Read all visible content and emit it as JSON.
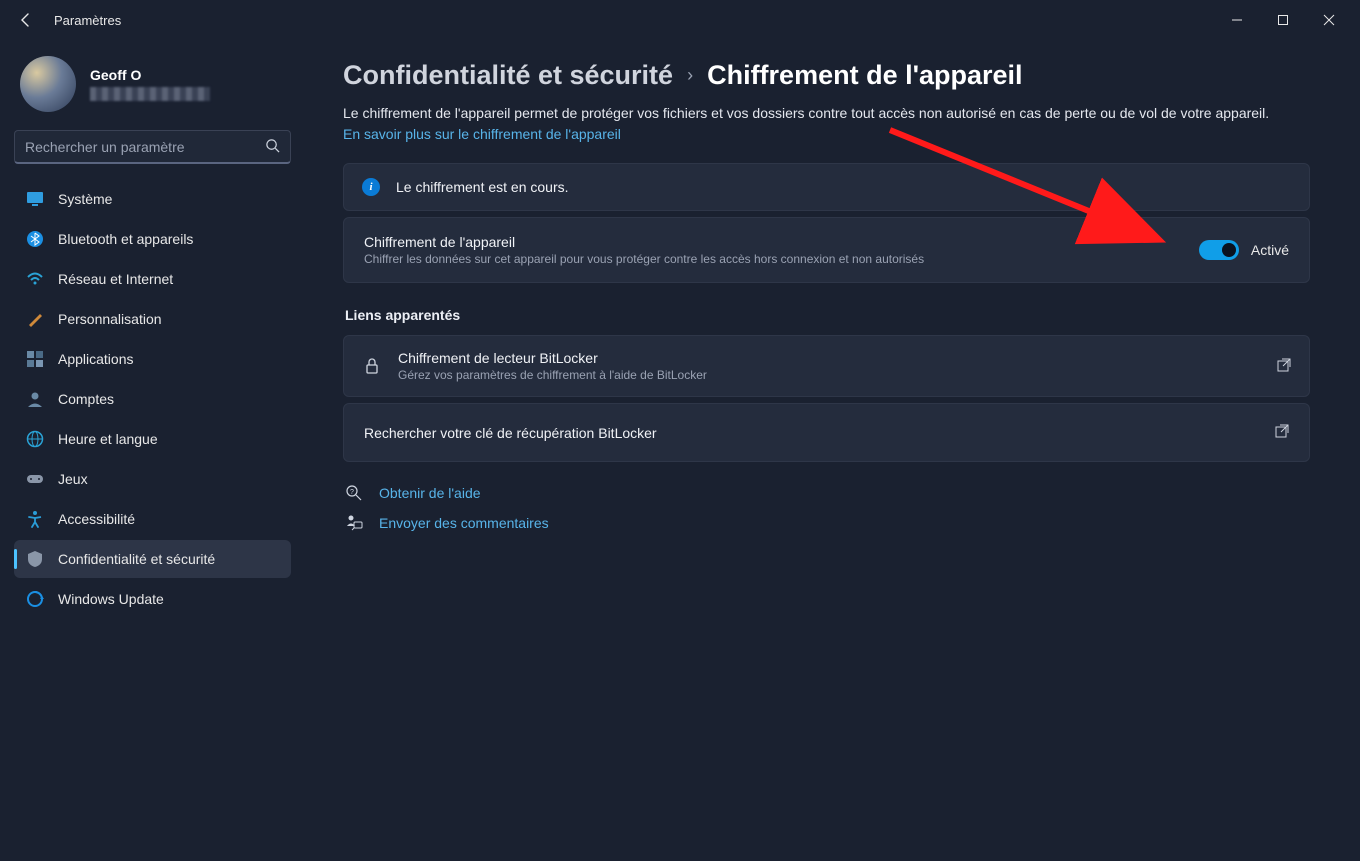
{
  "window": {
    "title": "Paramètres"
  },
  "user": {
    "name": "Geoff O"
  },
  "search": {
    "placeholder": "Rechercher un paramètre"
  },
  "sidebar": {
    "items": [
      {
        "label": "Système",
        "icon": "monitor",
        "color": "#2f9de0"
      },
      {
        "label": "Bluetooth et appareils",
        "icon": "bluetooth",
        "color": "#1a8fe3"
      },
      {
        "label": "Réseau et Internet",
        "icon": "wifi",
        "color": "#2aa3d6"
      },
      {
        "label": "Personnalisation",
        "icon": "brush",
        "color": "#d08a3a"
      },
      {
        "label": "Applications",
        "icon": "apps",
        "color": "#7a8aa6"
      },
      {
        "label": "Comptes",
        "icon": "account",
        "color": "#5a7a9a"
      },
      {
        "label": "Heure et langue",
        "icon": "globe",
        "color": "#2aa3d6"
      },
      {
        "label": "Jeux",
        "icon": "gamepad",
        "color": "#8a96a8"
      },
      {
        "label": "Accessibilité",
        "icon": "accessibility",
        "color": "#2a9cd6"
      },
      {
        "label": "Confidentialité et sécurité",
        "icon": "shield",
        "color": "#8a96a8",
        "active": true
      },
      {
        "label": "Windows Update",
        "icon": "update",
        "color": "#1a8fe3"
      }
    ]
  },
  "breadcrumb": {
    "parent": "Confidentialité et sécurité",
    "current": "Chiffrement de l'appareil"
  },
  "description": {
    "text": "Le chiffrement de l'appareil permet de protéger vos fichiers et vos dossiers contre tout accès non autorisé en cas de perte ou de vol de votre appareil. ",
    "link": "En savoir plus sur le chiffrement de l'appareil"
  },
  "status_banner": {
    "text": "Le chiffrement est en cours."
  },
  "toggle_card": {
    "title": "Chiffrement de l'appareil",
    "subtitle": "Chiffrer les données sur cet appareil pour vous protéger contre les accès hors connexion et non autorisés",
    "state_label": "Activé",
    "enabled": true
  },
  "related": {
    "heading": "Liens apparentés",
    "items": [
      {
        "title": "Chiffrement de lecteur BitLocker",
        "subtitle": "Gérez vos paramètres de chiffrement à l'aide de BitLocker",
        "icon": "lock"
      },
      {
        "title": "Rechercher votre clé de récupération BitLocker",
        "subtitle": "",
        "icon": ""
      }
    ]
  },
  "footer": {
    "help": "Obtenir de l'aide",
    "feedback": "Envoyer des commentaires"
  },
  "colors": {
    "accent": "#4cc2ff",
    "link": "#58b4e9",
    "toggle_on": "#109ee8"
  }
}
